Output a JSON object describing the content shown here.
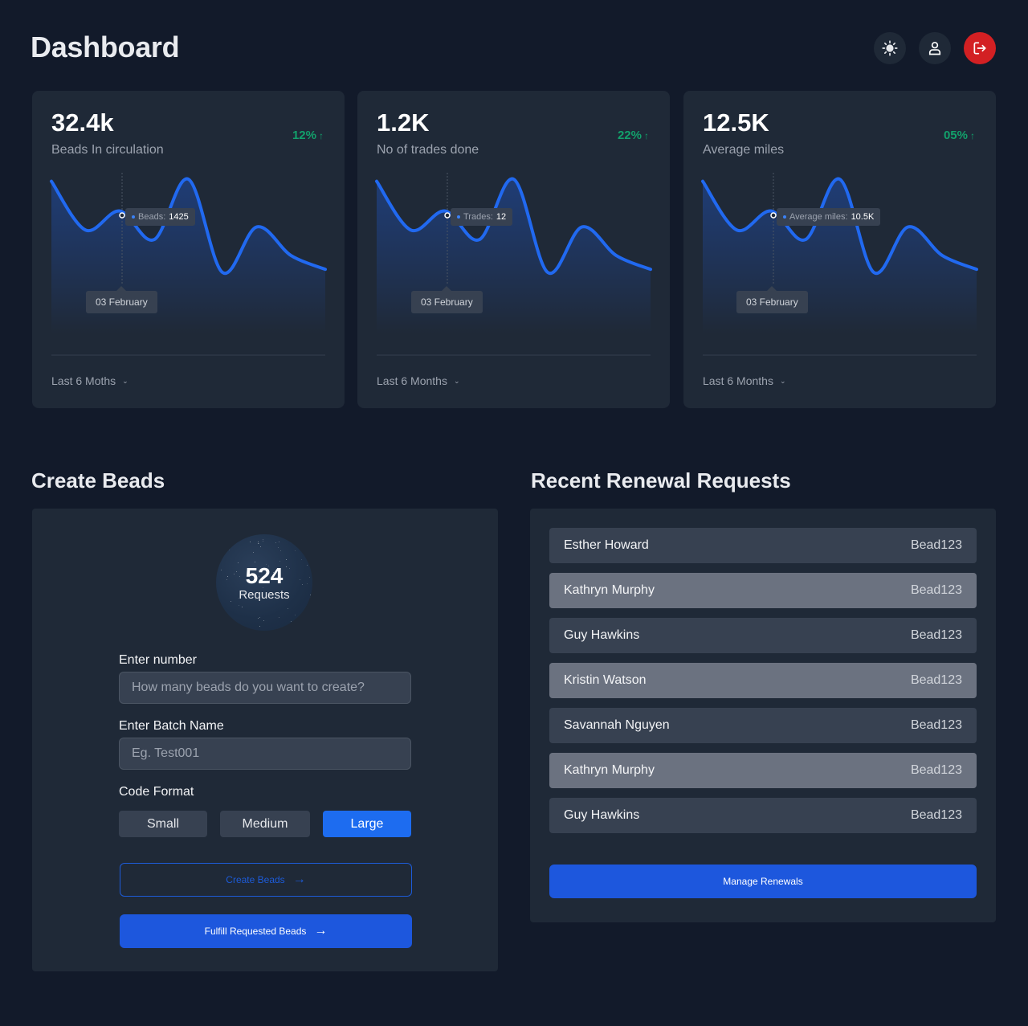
{
  "header": {
    "title": "Dashboard",
    "actions": [
      {
        "name": "theme-toggle-button",
        "icon": "sun-icon"
      },
      {
        "name": "profile-button",
        "icon": "user-icon"
      },
      {
        "name": "logout-button",
        "icon": "logout-icon"
      }
    ]
  },
  "colors": {
    "background": "#121a2a",
    "card": "#1f2937",
    "accent": "#1d6cf0",
    "line": "#2169f0",
    "positive": "#12a06b",
    "logout": "#d32023"
  },
  "stats": [
    {
      "value": "32.4k",
      "label": "Beads In circulation",
      "change": "12%",
      "change_icon": "arrow-up-icon",
      "tooltip_label": "Beads:",
      "tooltip_value": "1425",
      "date_label": "03 February",
      "period": "Last 6 Moths"
    },
    {
      "value": "1.2K",
      "label": "No of trades done",
      "change": "22%",
      "change_icon": "arrow-up-icon",
      "tooltip_label": "Trades:",
      "tooltip_value": "12",
      "date_label": "03 February",
      "period": "Last 6 Months"
    },
    {
      "value": "12.5K",
      "label": "Average miles",
      "change": "05%",
      "change_icon": "arrow-up-icon",
      "tooltip_label": "Average miles:",
      "tooltip_value": "10.5K",
      "date_label": "03 February",
      "period": "Last 6 Months"
    }
  ],
  "chart_data": [
    {
      "type": "area",
      "title": "Beads In circulation",
      "xlabel": "",
      "ylabel": "",
      "y_scale": "relative, unitless 0-100 (no axis shown)",
      "grid": false,
      "legend": "none",
      "highlighted_point": {
        "index": 2,
        "label": "03 February",
        "series": "Beads",
        "value": "1425"
      },
      "x": [
        0,
        1,
        2,
        3,
        4,
        5,
        6,
        7,
        8
      ],
      "values": [
        98,
        52,
        70,
        43,
        100,
        12,
        55,
        28,
        15
      ]
    },
    {
      "type": "area",
      "title": "No of trades done",
      "xlabel": "",
      "ylabel": "",
      "y_scale": "relative, unitless 0-100 (no axis shown)",
      "grid": false,
      "legend": "none",
      "highlighted_point": {
        "index": 2,
        "label": "03 February",
        "series": "Trades",
        "value": "12"
      },
      "x": [
        0,
        1,
        2,
        3,
        4,
        5,
        6,
        7,
        8
      ],
      "values": [
        98,
        52,
        70,
        43,
        100,
        12,
        55,
        28,
        15
      ]
    },
    {
      "type": "area",
      "title": "Average miles",
      "xlabel": "",
      "ylabel": "",
      "y_scale": "relative, unitless 0-100 (no axis shown)",
      "grid": false,
      "legend": "none",
      "highlighted_point": {
        "index": 2,
        "label": "03 February",
        "series": "Average miles",
        "value": "10.5K"
      },
      "x": [
        0,
        1,
        2,
        3,
        4,
        5,
        6,
        7,
        8
      ],
      "values": [
        98,
        52,
        70,
        43,
        100,
        12,
        55,
        28,
        15
      ]
    }
  ],
  "create_beads": {
    "title": "Create Beads",
    "requests_count": "524",
    "requests_label": "Requests",
    "number_label": "Enter number",
    "number_placeholder": "How many beads do you want to create?",
    "number_value": "",
    "batch_label": "Enter Batch Name",
    "batch_placeholder": "Eg. Test001",
    "batch_value": "",
    "format_label": "Code Format",
    "formats": [
      "Small",
      "Medium",
      "Large"
    ],
    "selected_format": "Large",
    "create_button": "Create Beads",
    "fulfill_button": "Fulfill Requested Beads"
  },
  "renewals": {
    "title": "Recent Renewal Requests",
    "items": [
      {
        "name": "Esther Howard",
        "code": "Bead123"
      },
      {
        "name": "Kathryn Murphy",
        "code": "Bead123"
      },
      {
        "name": "Guy Hawkins",
        "code": "Bead123"
      },
      {
        "name": "Kristin Watson",
        "code": "Bead123"
      },
      {
        "name": "Savannah Nguyen",
        "code": "Bead123"
      },
      {
        "name": "Kathryn Murphy",
        "code": "Bead123"
      },
      {
        "name": "Guy Hawkins",
        "code": "Bead123"
      }
    ],
    "manage_button": "Manage Renewals"
  }
}
